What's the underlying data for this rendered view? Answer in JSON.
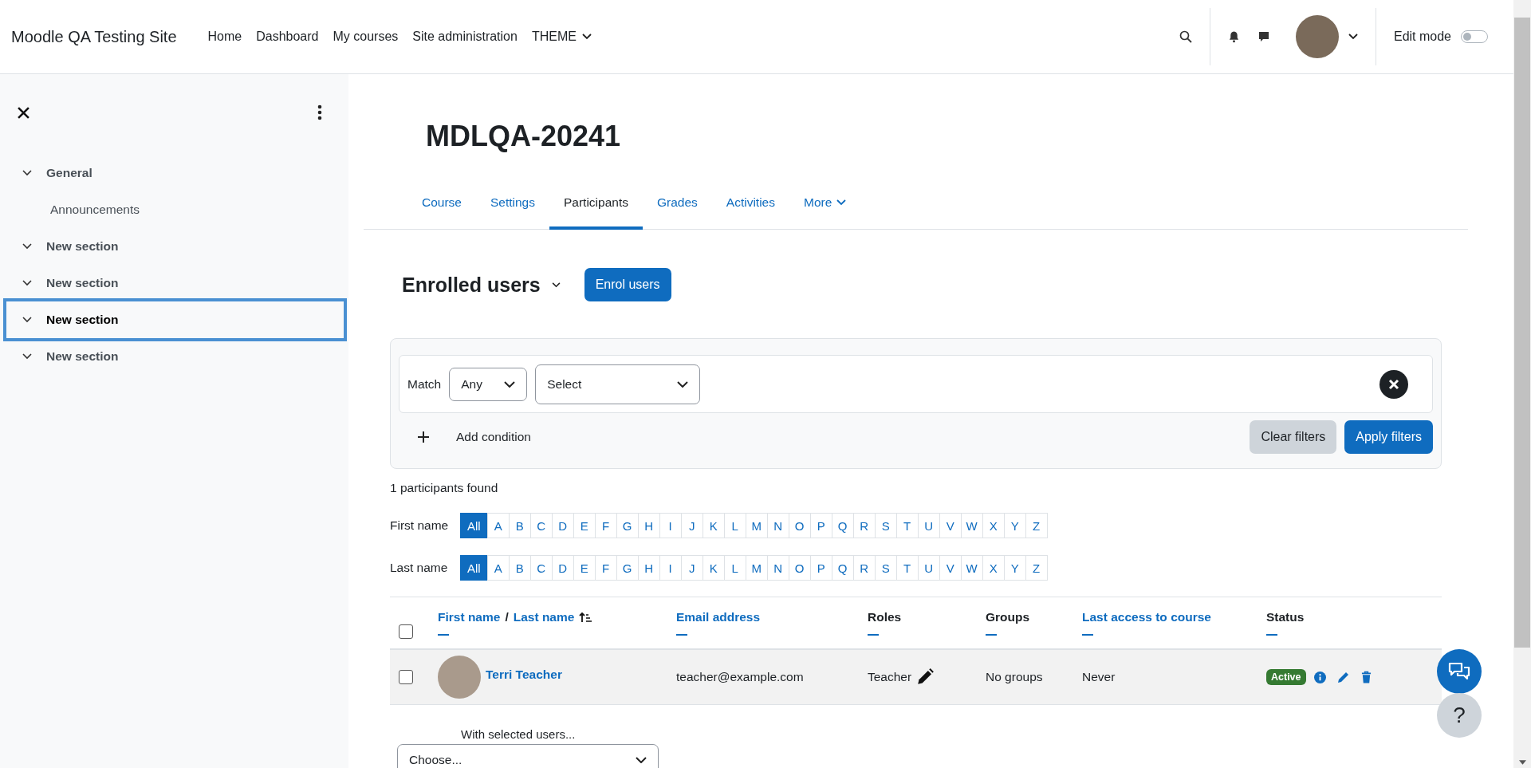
{
  "navbar": {
    "brand": "Moodle QA Testing Site",
    "items": [
      {
        "label": "Home",
        "dropdown": false
      },
      {
        "label": "Dashboard",
        "dropdown": false
      },
      {
        "label": "My courses",
        "dropdown": false
      },
      {
        "label": "Site administration",
        "dropdown": false
      },
      {
        "label": "THEME",
        "dropdown": true
      }
    ],
    "edit_mode": {
      "label": "Edit mode",
      "on": false
    }
  },
  "sidebar": {
    "sections": [
      {
        "label": "General",
        "expanded": true,
        "selected": false,
        "children": [
          {
            "label": "Announcements"
          }
        ]
      },
      {
        "label": "New section",
        "expanded": true,
        "selected": false
      },
      {
        "label": "New section",
        "expanded": true,
        "selected": false
      },
      {
        "label": "New section",
        "expanded": true,
        "selected": true
      },
      {
        "label": "New section",
        "expanded": true,
        "selected": false
      }
    ]
  },
  "course": {
    "title": "MDLQA-20241"
  },
  "tabs": [
    {
      "label": "Course",
      "selected": false,
      "dropdown": false
    },
    {
      "label": "Settings",
      "selected": false,
      "dropdown": false
    },
    {
      "label": "Participants",
      "selected": true,
      "dropdown": false
    },
    {
      "label": "Grades",
      "selected": false,
      "dropdown": false
    },
    {
      "label": "Activities",
      "selected": false,
      "dropdown": false
    },
    {
      "label": "More",
      "selected": false,
      "dropdown": true
    }
  ],
  "page_heading": "Enrolled users",
  "enrol_button": "Enrol users",
  "filter": {
    "match_label": "Match",
    "match_value": "Any",
    "select_value": "Select",
    "add_condition": "Add condition",
    "clear_button": "Clear filters",
    "apply_button": "Apply filters"
  },
  "found": "1 participants found",
  "initials_bars": [
    {
      "label": "First name",
      "letters": [
        {
          "label": "All",
          "selected": true
        },
        {
          "label": "A",
          "selected": false
        },
        {
          "label": "B",
          "selected": false
        },
        {
          "label": "C",
          "selected": false
        },
        {
          "label": "D",
          "selected": false
        },
        {
          "label": "E",
          "selected": false
        },
        {
          "label": "F",
          "selected": false
        },
        {
          "label": "G",
          "selected": false
        },
        {
          "label": "H",
          "selected": false
        },
        {
          "label": "I",
          "selected": false
        },
        {
          "label": "J",
          "selected": false
        },
        {
          "label": "K",
          "selected": false
        },
        {
          "label": "L",
          "selected": false
        },
        {
          "label": "M",
          "selected": false
        },
        {
          "label": "N",
          "selected": false
        },
        {
          "label": "O",
          "selected": false
        },
        {
          "label": "P",
          "selected": false
        },
        {
          "label": "Q",
          "selected": false
        },
        {
          "label": "R",
          "selected": false
        },
        {
          "label": "S",
          "selected": false
        },
        {
          "label": "T",
          "selected": false
        },
        {
          "label": "U",
          "selected": false
        },
        {
          "label": "V",
          "selected": false
        },
        {
          "label": "W",
          "selected": false
        },
        {
          "label": "X",
          "selected": false
        },
        {
          "label": "Y",
          "selected": false
        },
        {
          "label": "Z",
          "selected": false
        }
      ]
    },
    {
      "label": "Last name",
      "letters": [
        {
          "label": "All",
          "selected": true
        },
        {
          "label": "A",
          "selected": false
        },
        {
          "label": "B",
          "selected": false
        },
        {
          "label": "C",
          "selected": false
        },
        {
          "label": "D",
          "selected": false
        },
        {
          "label": "E",
          "selected": false
        },
        {
          "label": "F",
          "selected": false
        },
        {
          "label": "G",
          "selected": false
        },
        {
          "label": "H",
          "selected": false
        },
        {
          "label": "I",
          "selected": false
        },
        {
          "label": "J",
          "selected": false
        },
        {
          "label": "K",
          "selected": false
        },
        {
          "label": "L",
          "selected": false
        },
        {
          "label": "M",
          "selected": false
        },
        {
          "label": "N",
          "selected": false
        },
        {
          "label": "O",
          "selected": false
        },
        {
          "label": "P",
          "selected": false
        },
        {
          "label": "Q",
          "selected": false
        },
        {
          "label": "R",
          "selected": false
        },
        {
          "label": "S",
          "selected": false
        },
        {
          "label": "T",
          "selected": false
        },
        {
          "label": "U",
          "selected": false
        },
        {
          "label": "V",
          "selected": false
        },
        {
          "label": "W",
          "selected": false
        },
        {
          "label": "X",
          "selected": false
        },
        {
          "label": "Y",
          "selected": false
        },
        {
          "label": "Z",
          "selected": false
        }
      ]
    }
  ],
  "table": {
    "select_all_checked": false,
    "columns": [
      {
        "kind": "name",
        "parts": [
          "First name",
          "Last name"
        ],
        "separator": "/",
        "sorted_ascending": true
      },
      {
        "kind": "link",
        "label": "Email address"
      },
      {
        "kind": "plain",
        "label": "Roles"
      },
      {
        "kind": "plain",
        "label": "Groups"
      },
      {
        "kind": "link",
        "label": "Last access to course"
      },
      {
        "kind": "plain",
        "label": "Status"
      }
    ],
    "rows": [
      {
        "checked": false,
        "name": "Terri Teacher",
        "email": "teacher@example.com",
        "role": "Teacher",
        "groups": "No groups",
        "last_access": "Never",
        "status": "Active"
      }
    ]
  },
  "bulk": {
    "label": "With selected users...",
    "select_value": "Choose..."
  },
  "help_button": "?"
}
